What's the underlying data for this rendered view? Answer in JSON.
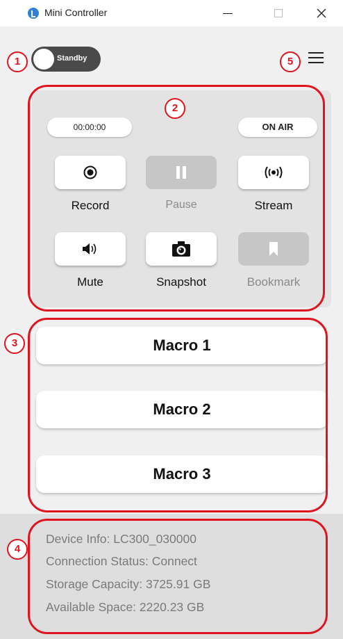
{
  "window": {
    "title": "Mini Controller",
    "logo_icon": "app-logo-icon"
  },
  "mode_toggle": {
    "label": "Standby",
    "state": "off"
  },
  "menu": {
    "icon": "hamburger-menu-icon"
  },
  "callouts": [
    "1",
    "2",
    "3",
    "4",
    "5"
  ],
  "status": {
    "timer": "00:00:00",
    "on_air": "ON AIR"
  },
  "controls": [
    {
      "label": "Record",
      "icon": "record-icon",
      "enabled": true
    },
    {
      "label": "Pause",
      "icon": "pause-icon",
      "enabled": false
    },
    {
      "label": "Stream",
      "icon": "stream-icon",
      "enabled": true
    },
    {
      "label": "Mute",
      "icon": "speaker-icon",
      "enabled": true
    },
    {
      "label": "Snapshot",
      "icon": "camera-icon",
      "enabled": true
    },
    {
      "label": "Bookmark",
      "icon": "bookmark-icon",
      "enabled": false
    }
  ],
  "macros": [
    "Macro 1",
    "Macro 2",
    "Macro 3"
  ],
  "device_info": [
    "Device Info: LC300_030000",
    "Connection Status: Connect",
    "Storage Capacity: 3725.91 GB",
    "Available Space: 2220.23 GB"
  ],
  "colors": {
    "callout": "#e0141e",
    "toggle": "#4a4a4a",
    "disabled": "#c6c6c6"
  }
}
